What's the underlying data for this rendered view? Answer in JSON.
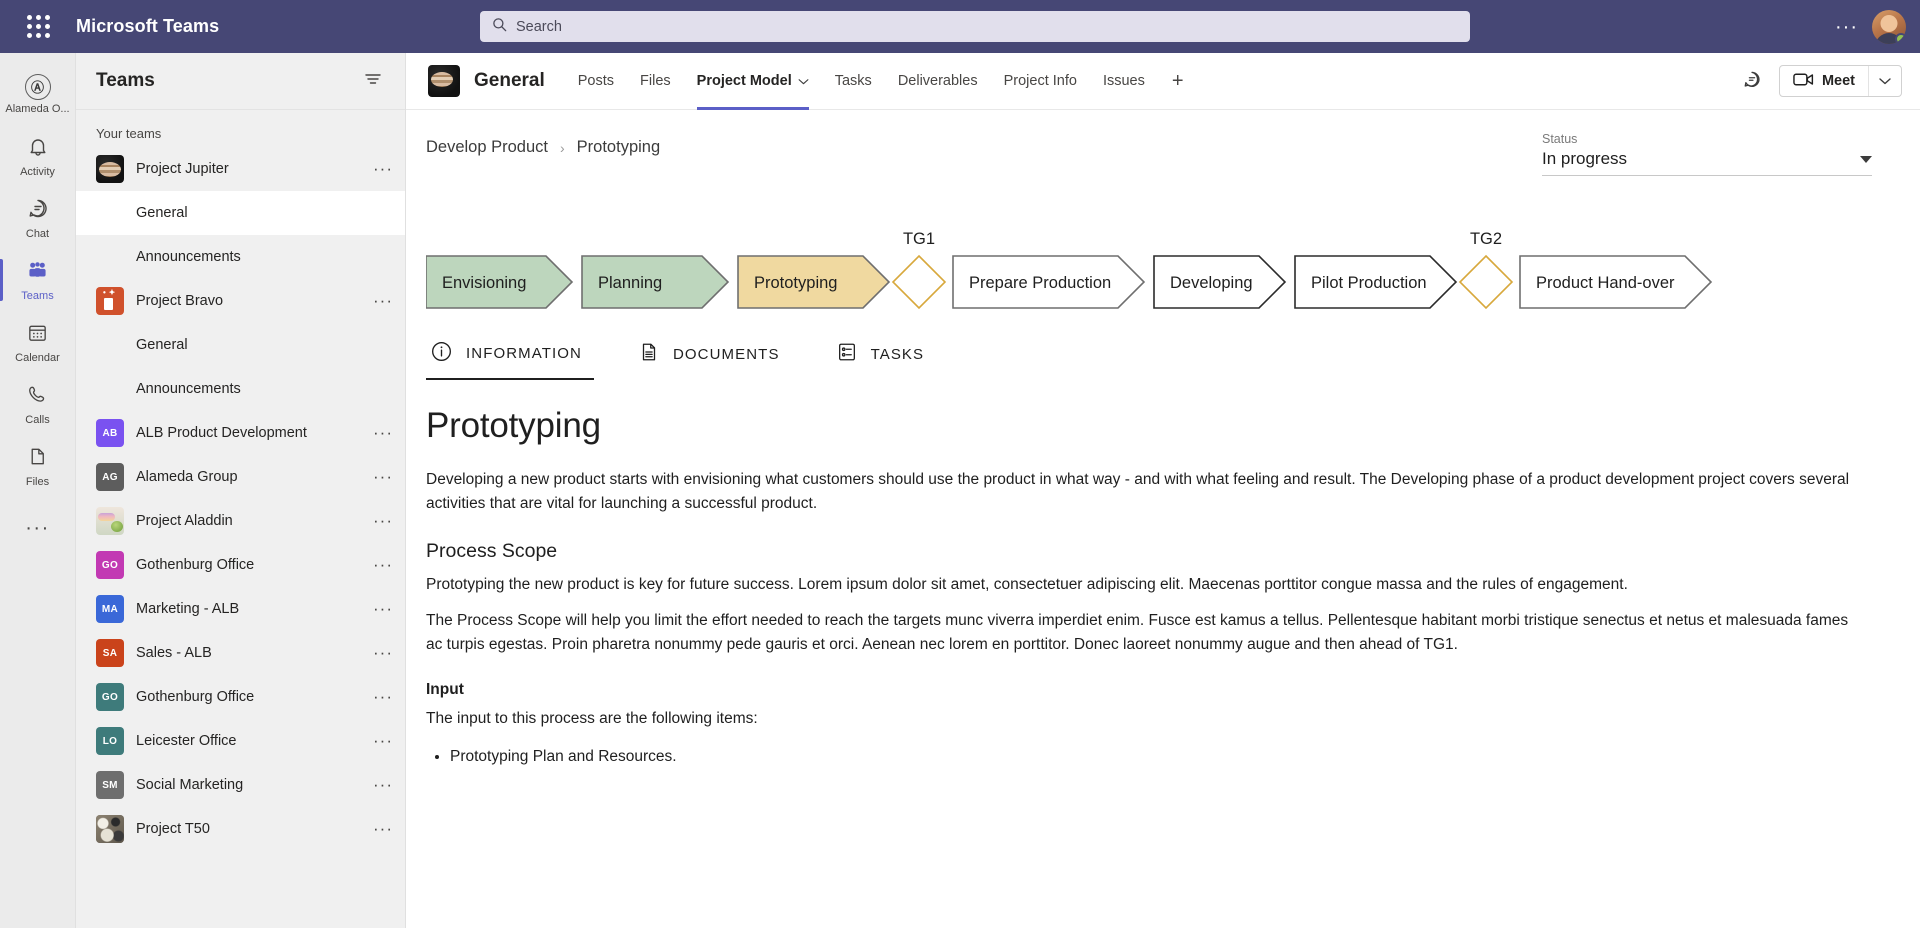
{
  "titlebar": {
    "app_title": "Microsoft Teams",
    "waffle_icon": "app-launcher-icon",
    "search": {
      "placeholder": "Search",
      "icon": "search-icon"
    },
    "more_icon": "ellipsis-icon",
    "avatar_icon": "user-avatar",
    "presence_status": "available",
    "presence_color": "#92c353",
    "background_color": "#464775"
  },
  "rail": {
    "items": [
      {
        "label": "Alameda O...",
        "icon": "org-logo-icon",
        "active": false
      },
      {
        "label": "Activity",
        "icon": "bell-icon",
        "active": false
      },
      {
        "label": "Chat",
        "icon": "chat-bubble-icon",
        "active": false
      },
      {
        "label": "Teams",
        "icon": "teams-people-icon",
        "active": true
      },
      {
        "label": "Calendar",
        "icon": "calendar-icon",
        "active": false
      },
      {
        "label": "Calls",
        "icon": "phone-icon",
        "active": false
      },
      {
        "label": "Files",
        "icon": "file-icon",
        "active": false
      }
    ],
    "more_icon": "ellipsis-icon",
    "active_accent": "#5b5fc7"
  },
  "teams_panel": {
    "title": "Teams",
    "filter_icon": "filter-icon",
    "group_label": "Your teams",
    "row_more_icon": "ellipsis-icon",
    "items": [
      {
        "type": "team",
        "name": "Project Jupiter",
        "avatar_kind": "image-jupiter",
        "initials": "",
        "color": "#1a1a1a"
      },
      {
        "type": "channel",
        "name": "General",
        "selected": true
      },
      {
        "type": "channel",
        "name": "Announcements",
        "selected": false
      },
      {
        "type": "team",
        "name": "Project Bravo",
        "avatar_kind": "image-bravo",
        "initials": "",
        "color": "#d0512c"
      },
      {
        "type": "channel",
        "name": "General",
        "selected": false
      },
      {
        "type": "channel",
        "name": "Announcements",
        "selected": false
      },
      {
        "type": "team",
        "name": "ALB Product Development",
        "avatar_kind": "initials",
        "initials": "AB",
        "color": "#7a52f0"
      },
      {
        "type": "team",
        "name": "Alameda Group",
        "avatar_kind": "initials",
        "initials": "AG",
        "color": "#5d5d5d"
      },
      {
        "type": "team",
        "name": "Project Aladdin",
        "avatar_kind": "image-aladdin",
        "initials": "",
        "color": "#d8c4b0"
      },
      {
        "type": "team",
        "name": "Gothenburg Office",
        "avatar_kind": "initials",
        "initials": "GO",
        "color": "#c239b3"
      },
      {
        "type": "team",
        "name": "Marketing - ALB",
        "avatar_kind": "initials",
        "initials": "MA",
        "color": "#3a68d8"
      },
      {
        "type": "team",
        "name": "Sales - ALB",
        "avatar_kind": "initials",
        "initials": "SA",
        "color": "#ca431b"
      },
      {
        "type": "team",
        "name": "Gothenburg Office",
        "avatar_kind": "initials",
        "initials": "GO",
        "color": "#3e7b7b"
      },
      {
        "type": "team",
        "name": "Leicester Office",
        "avatar_kind": "initials",
        "initials": "LO",
        "color": "#3e7b7b"
      },
      {
        "type": "team",
        "name": "Social Marketing",
        "avatar_kind": "initials",
        "initials": "SM",
        "color": "#6e6e6e"
      },
      {
        "type": "team",
        "name": "Project T50",
        "avatar_kind": "image-t50",
        "initials": "",
        "color": "#6b6357"
      }
    ]
  },
  "channel_header": {
    "avatar_icon": "team-avatar-jupiter",
    "title": "General",
    "tabs": [
      {
        "label": "Posts",
        "active": false,
        "has_caret": false
      },
      {
        "label": "Files",
        "active": false,
        "has_caret": false
      },
      {
        "label": "Project Model",
        "active": true,
        "has_caret": true
      },
      {
        "label": "Tasks",
        "active": false,
        "has_caret": false
      },
      {
        "label": "Deliverables",
        "active": false,
        "has_caret": false
      },
      {
        "label": "Project Info",
        "active": false,
        "has_caret": false
      },
      {
        "label": "Issues",
        "active": false,
        "has_caret": false
      }
    ],
    "add_tab_label": "+",
    "conversation_icon": "chat-bubble-icon",
    "meet_label": "Meet",
    "meet_icon": "video-camera-icon",
    "meet_caret_icon": "chevron-down-icon",
    "active_tab_accent": "#5b5fc7"
  },
  "app_canvas": {
    "breadcrumb": {
      "items": [
        "Develop Product",
        "Prototyping"
      ],
      "separator": "›"
    },
    "status": {
      "label": "Status",
      "value": "In progress",
      "caret_icon": "chevron-down-icon"
    },
    "flow": {
      "stages": [
        {
          "label": "Envisioning",
          "state": "complete",
          "fill": "#bdd6bd",
          "stroke": "#6f6f6f"
        },
        {
          "label": "Planning",
          "state": "complete",
          "fill": "#bdd6bd",
          "stroke": "#6f6f6f"
        },
        {
          "label": "Prototyping",
          "state": "current",
          "fill": "#f0d9a0",
          "stroke": "#6f6f6f"
        },
        {
          "label": "Prepare Production",
          "state": "upcoming",
          "fill": "#ffffff",
          "stroke": "#6f6f6f"
        },
        {
          "label": "Developing",
          "state": "upcoming",
          "fill": "#ffffff",
          "stroke": "#2b2b2b"
        },
        {
          "label": "Pilot Production",
          "state": "upcoming",
          "fill": "#ffffff",
          "stroke": "#2b2b2b"
        },
        {
          "label": "Product Hand-over",
          "state": "upcoming",
          "fill": "#ffffff",
          "stroke": "#6f6f6f"
        }
      ],
      "gates": [
        {
          "label": "TG1",
          "after_stage": 2,
          "stroke": "#d8a83c"
        },
        {
          "label": "TG2",
          "after_stage": 5,
          "stroke": "#d8a83c"
        }
      ]
    },
    "subtabs": [
      {
        "label": "INFORMATION",
        "icon": "info-circle-icon",
        "active": true
      },
      {
        "label": "DOCUMENTS",
        "icon": "document-icon",
        "active": false
      },
      {
        "label": "TASKS",
        "icon": "task-list-icon",
        "active": false
      }
    ],
    "article": {
      "title": "Prototyping",
      "intro": "Developing a new product starts with envisioning what customers should use the product in what way - and with what feeling and result. The Developing phase of a product development project covers several activities that are vital for launching a successful product.",
      "section1_heading": "Process Scope",
      "section1_p1": "Prototyping the new product is key for future success. Lorem ipsum dolor sit amet, consectetuer adipiscing elit. Maecenas porttitor congue massa and the rules of engagement.",
      "section1_p2": "The Process Scope will help you limit the effort needed to reach the targets munc viverra imperdiet enim. Fusce est kamus a tellus. Pellentesque habitant morbi tristique senectus et netus et malesuada fames ac turpis egestas. Proin pharetra nonummy pede gauris et orci. Aenean nec lorem en porttitor. Donec laoreet nonummy augue and then ahead of TG1.",
      "section2_heading": "Input",
      "section2_p1": "The input to this process are the following items:",
      "bullets": [
        "Prototyping Plan and Resources."
      ]
    }
  }
}
